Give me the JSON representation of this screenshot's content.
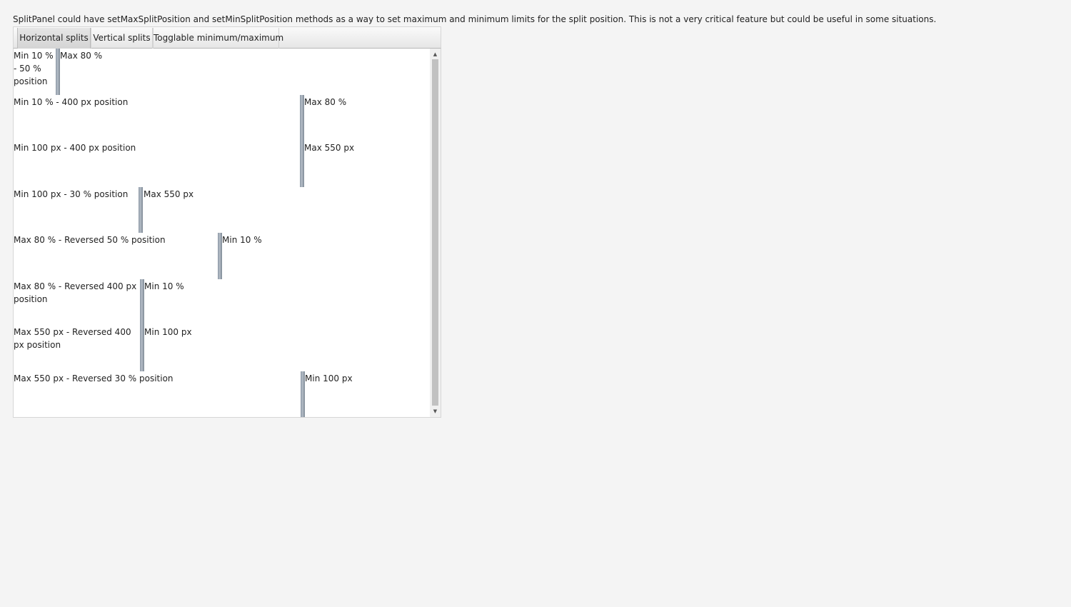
{
  "description": "SplitPanel could have setMaxSplitPosition and setMinSplitPosition methods as a way to set maximum and minimum limits for the split position. This is not a very critical feature but could be useful in some situations.",
  "tabs": [
    {
      "label": "Horizontal splits",
      "selected": true
    },
    {
      "label": "Vertical splits",
      "selected": false
    },
    {
      "label": "Togglable minimum/maximum",
      "selected": false
    }
  ],
  "splits": [
    {
      "first_label": "Min 10 % - 50 % position",
      "second_label": "Max 80 %"
    },
    {
      "first_label": "Min 10 % - 400 px position",
      "second_label": "Max 80 %"
    },
    {
      "first_label": "Min 100 px - 400 px position",
      "second_label": "Max 550 px"
    },
    {
      "first_label": "Min 100 px - 30 % position",
      "second_label": "Max 550 px"
    },
    {
      "first_label": "Max 80 % - Reversed 50 % position",
      "second_label": "Min 10 %"
    },
    {
      "first_label": "Max 80 % - Reversed 400 px position",
      "second_label": "Min 10 %"
    },
    {
      "first_label": "Max 550 px - Reversed 400 px position",
      "second_label": "Min 100 px"
    },
    {
      "first_label": "Max 550 px - Reversed 30 % position",
      "second_label": "Min 100 px"
    }
  ],
  "scrollbar": {
    "up_icon": "triangle-up-icon",
    "down_icon": "triangle-down-icon"
  },
  "colors": {
    "splitter": "#9aa5b1",
    "selected_tab": "#d9d9d9",
    "background": "#f4f4f4"
  }
}
